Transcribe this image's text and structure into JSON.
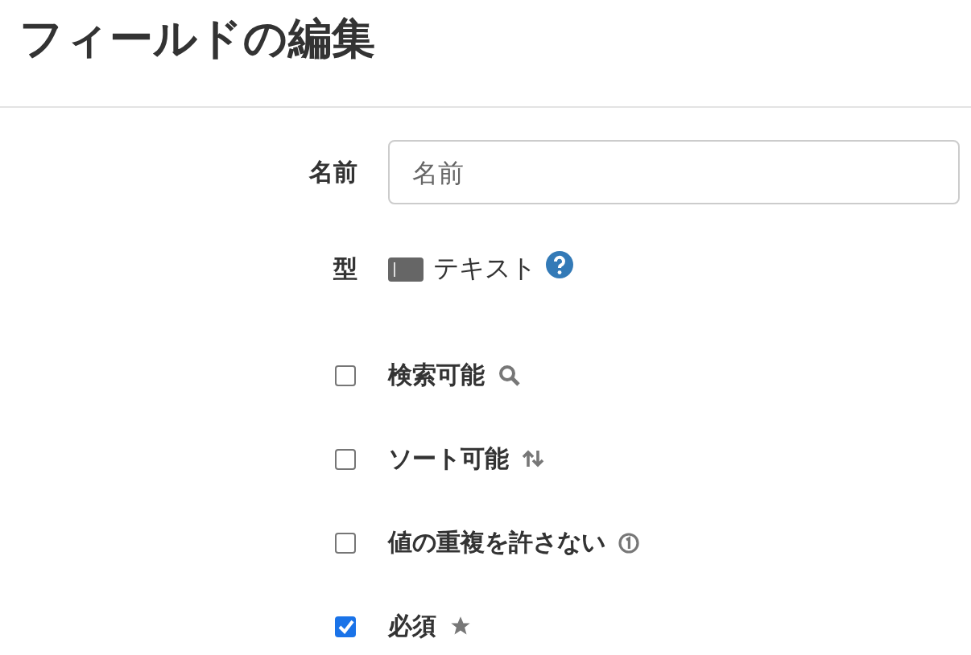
{
  "page": {
    "title": "フィールドの編集"
  },
  "name_field": {
    "label": "名前",
    "placeholder": "名前"
  },
  "type_field": {
    "label": "型",
    "value": "テキスト"
  },
  "options": [
    {
      "label": "検索可能",
      "checked": false,
      "kind": "search"
    },
    {
      "label": "ソート可能",
      "checked": false,
      "kind": "sort"
    },
    {
      "label": "値の重複を許さない",
      "checked": false,
      "kind": "unique"
    },
    {
      "label": "必須",
      "checked": true,
      "kind": "required"
    }
  ]
}
